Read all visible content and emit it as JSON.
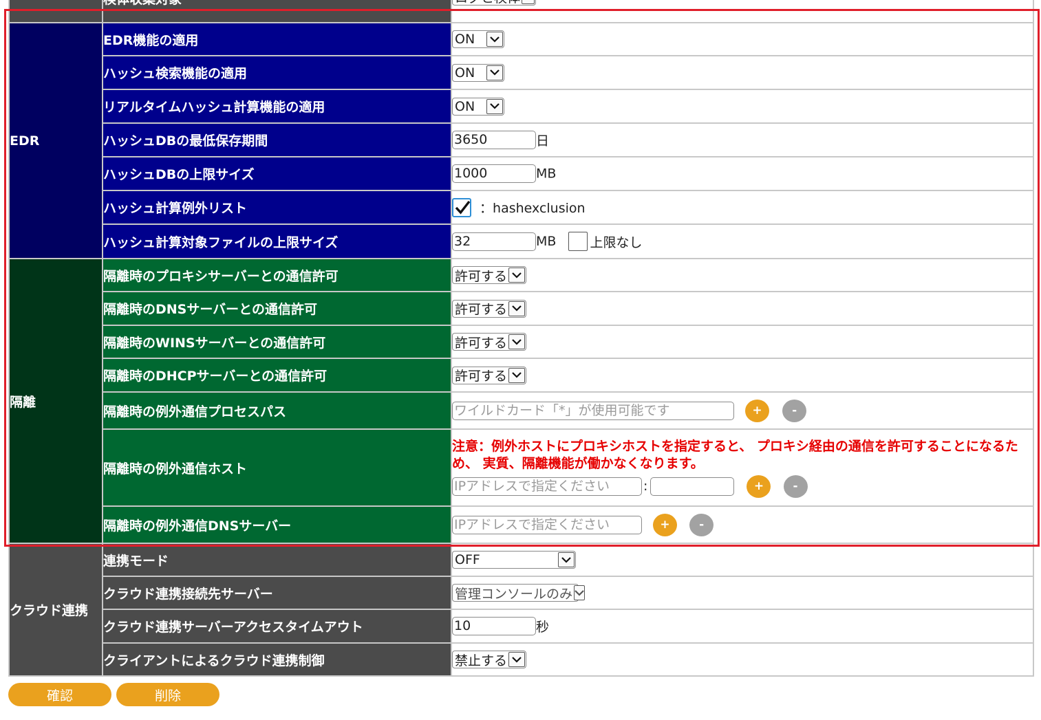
{
  "colors": {
    "highlight_frame": "#e01e2a",
    "accent_button": "#eaa11e",
    "remove_button": "#a2a2a2",
    "edr_label_bg": "#00008c",
    "isolation_label_bg": "#006831",
    "default_label_bg": "#4b4b4b"
  },
  "top_row": {
    "label": "検体収集対象",
    "select_value": "ログと検体"
  },
  "edr": {
    "section": "EDR",
    "edr_function": {
      "label": "EDR機能の適用",
      "value": "ON"
    },
    "hash_search": {
      "label": "ハッシュ検索機能の適用",
      "value": "ON"
    },
    "realtime_hash": {
      "label": "リアルタイムハッシュ計算機能の適用",
      "value": "ON"
    },
    "hash_db_retention": {
      "label": "ハッシュDBの最低保存期間",
      "value": "3650",
      "unit": "日"
    },
    "hash_db_limit": {
      "label": "ハッシュDBの上限サイズ",
      "value": "1000",
      "unit": "MB"
    },
    "hash_exclusion": {
      "label": "ハッシュ計算例外リスト",
      "checked": true,
      "text": "：hashexclusion"
    },
    "hash_file_limit": {
      "label": "ハッシュ計算対象ファイルの上限サイズ",
      "value": "32",
      "unit": "MB",
      "no_limit_label": "上限なし",
      "no_limit_checked": false
    }
  },
  "isolation": {
    "section": "隔離",
    "proxy": {
      "label": "隔離時のプロキシサーバーとの通信許可",
      "value": "許可する"
    },
    "dns": {
      "label": "隔離時のDNSサーバーとの通信許可",
      "value": "許可する"
    },
    "wins": {
      "label": "隔離時のWINSサーバーとの通信許可",
      "value": "許可する"
    },
    "dhcp": {
      "label": "隔離時のDHCPサーバーとの通信許可",
      "value": "許可する"
    },
    "exception_process": {
      "label": "隔離時の例外通信プロセスパス",
      "placeholder": "ワイルドカード「*」が使用可能です",
      "add": "+",
      "remove": "-"
    },
    "exception_host": {
      "label": "隔離時の例外通信ホスト",
      "warning": "注意：例外ホストにプロキシホストを指定すると、 プロキシ経由の通信を許可することになるため、 実質、隔離機能が働かなくなります。",
      "placeholder": "IPアドレスで指定ください",
      "separator": ":",
      "add": "+",
      "remove": "-"
    },
    "exception_dns": {
      "label": "隔離時の例外通信DNSサーバー",
      "placeholder": "IPアドレスで指定ください",
      "add": "+",
      "remove": "-"
    }
  },
  "cloud": {
    "section": "クラウド連携",
    "mode": {
      "label": "連携モード",
      "value": "OFF"
    },
    "server": {
      "label": "クラウド連携接続先サーバー",
      "value": "管理コンソールのみ"
    },
    "timeout": {
      "label": "クラウド連携サーバーアクセスタイムアウト",
      "value": "10",
      "unit": "秒"
    },
    "client_control": {
      "label": "クライアントによるクラウド連携制御",
      "value": "禁止する"
    }
  },
  "buttons": {
    "confirm": "確認",
    "delete": "削除"
  }
}
